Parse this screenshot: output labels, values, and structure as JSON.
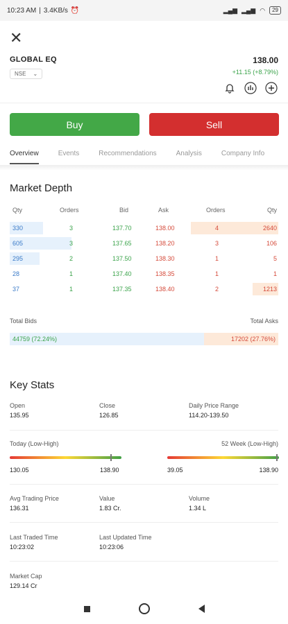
{
  "status": {
    "time": "10:23 AM",
    "speed": "3.4KB/s",
    "battery": "29"
  },
  "stock": {
    "name": "GLOBAL EQ",
    "exchange": "NSE",
    "price": "138.00",
    "change": "+11.15 (+8.79%)"
  },
  "actions": {
    "buy": "Buy",
    "sell": "Sell"
  },
  "tabs": [
    "Overview",
    "Events",
    "Recommendations",
    "Analysis",
    "Company Info"
  ],
  "market_depth": {
    "title": "Market Depth",
    "headers": {
      "qty": "Qty",
      "orders": "Orders",
      "bid": "Bid",
      "ask": "Ask",
      "orders2": "Orders",
      "qty2": "Qty"
    },
    "rows": [
      {
        "bid_qty": "330",
        "bid_orders": "3",
        "bid": "137.70",
        "ask": "138.00",
        "ask_orders": "4",
        "ask_qty": "2640",
        "bid_fill": 0.125,
        "ask_fill": 0.325
      },
      {
        "bid_qty": "605",
        "bid_orders": "3",
        "bid": "137.65",
        "ask": "138.20",
        "ask_orders": "3",
        "ask_qty": "106",
        "bid_fill": 0.23,
        "ask_fill": 0
      },
      {
        "bid_qty": "295",
        "bid_orders": "2",
        "bid": "137.50",
        "ask": "138.30",
        "ask_orders": "1",
        "ask_qty": "5",
        "bid_fill": 0.11,
        "ask_fill": 0
      },
      {
        "bid_qty": "28",
        "bid_orders": "1",
        "bid": "137.40",
        "ask": "138.35",
        "ask_orders": "1",
        "ask_qty": "1",
        "bid_fill": 0,
        "ask_fill": 0
      },
      {
        "bid_qty": "37",
        "bid_orders": "1",
        "bid": "137.35",
        "ask": "138.40",
        "ask_orders": "2",
        "ask_qty": "1213",
        "bid_fill": 0,
        "ask_fill": 0.095
      }
    ],
    "total_bids_label": "Total Bids",
    "total_asks_label": "Total Asks",
    "total_bids": "44759 (72.24%)",
    "total_asks": "17202 (27.76%)",
    "bid_share": 0.7224
  },
  "key_stats": {
    "title": "Key Stats",
    "open_label": "Open",
    "open": "135.95",
    "close_label": "Close",
    "close": "126.85",
    "daily_range_label": "Daily Price Range",
    "daily_range": "114.20-139.50",
    "today_label": "Today (Low-High)",
    "today_low": "130.05",
    "today_high": "138.90",
    "today_pos": 0.9,
    "week52_label": "52 Week (Low-High)",
    "week52_low": "39.05",
    "week52_high": "138.90",
    "week52_pos": 0.99,
    "atp_label": "Avg Trading Price",
    "atp": "136.31",
    "value_label": "Value",
    "value": "1.83 Cr.",
    "volume_label": "Volume",
    "volume": "1.34 L",
    "ltt_label": "Last Traded Time",
    "ltt": "10:23:02",
    "lut_label": "Last Updated Time",
    "lut": "10:23:06",
    "mcap_label": "Market Cap",
    "mcap": "129.14 Cr"
  }
}
